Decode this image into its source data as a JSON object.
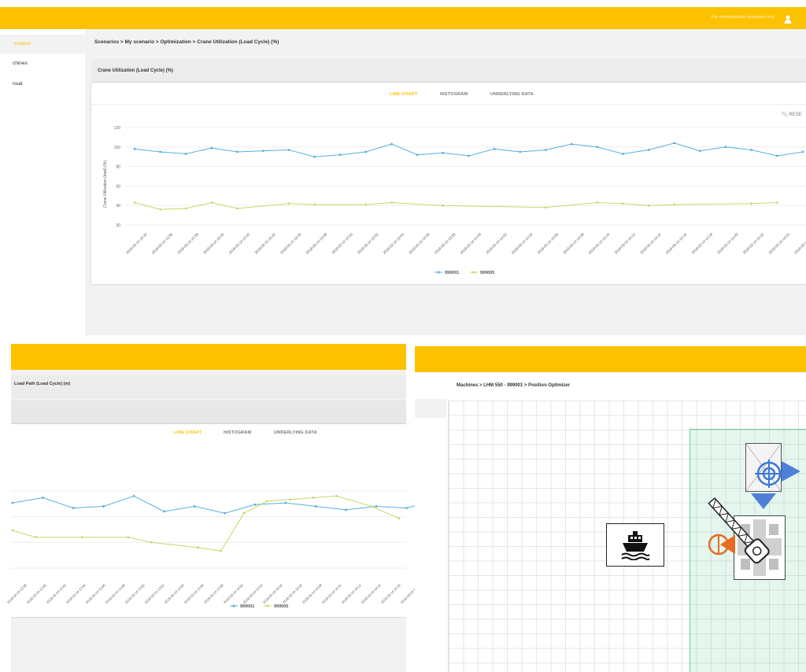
{
  "top": {
    "header_notice": "For demonstration purposes only",
    "sidebar": {
      "items": [
        {
          "label": "enarios",
          "active": true
        },
        {
          "label": "chines"
        },
        {
          "label": "nual"
        }
      ]
    },
    "breadcrumb": [
      "Scenarios",
      "My scenario",
      "Optimization",
      "Crane Utilization (Load Cycle) (%)"
    ],
    "card_title": "Crane Utilization (Load Cycle) (%)",
    "tabs": [
      "LINE CHART",
      "HISTOGRAM",
      "UNDERLYING DATA"
    ],
    "reset_label": "RESE"
  },
  "bottom_left": {
    "card_title": "Load Path (Load Cycle) (m)",
    "tabs": [
      "LINE CHART",
      "HISTOGRAM",
      "UNDERLYING DATA"
    ]
  },
  "bottom_right": {
    "breadcrumb": [
      "Machines",
      "LHM 550 - 999001",
      "Position Optimizer"
    ]
  },
  "colors": {
    "accent": "#fcc200",
    "series1": "#5aaee0",
    "series2": "#c6d86a",
    "zone": "#2eb873"
  },
  "chart_data": [
    {
      "type": "line",
      "ylabel": "Crane Utilization (load) (%)",
      "yticks": [
        20,
        40,
        60,
        80,
        100,
        120
      ],
      "ylim": [
        20,
        120
      ],
      "grid": true,
      "legend_position": "bottom",
      "x": [
        "2018-03-14 13:34",
        "2018-03-14 13:36",
        "2018-03-14 13:38",
        "2018-03-14 13:40",
        "2018-03-14 13:42",
        "2018-03-14 13:44",
        "2018-03-14 13:46",
        "2018-03-14 13:48",
        "2018-03-14 13:50",
        "2018-03-14 13:52",
        "2018-03-14 13:54",
        "2018-03-14 13:56",
        "2018-03-14 13:58",
        "2018-03-14 14:00",
        "2018-03-14 14:02",
        "2018-03-14 14:04",
        "2018-03-14 14:06",
        "2018-03-14 14:08",
        "2018-03-14 14:10",
        "2018-03-14 14:12",
        "2018-03-14 14:14",
        "2018-03-14 14:16",
        "2018-03-14 14:18",
        "2018-03-14 14:20",
        "2018-03-14 14:22",
        "2018-03-14 14:24",
        "2018-03-14 14:26"
      ],
      "series": [
        {
          "name": "999001",
          "values": [
            98,
            95,
            93,
            99,
            95,
            96,
            97,
            90,
            92,
            95,
            103,
            92,
            94,
            91,
            98,
            95,
            97,
            103,
            100,
            93,
            97,
            104,
            96,
            100,
            97,
            91,
            95
          ]
        },
        {
          "name": "999005",
          "values": [
            43,
            36,
            37,
            43,
            37,
            null,
            42,
            41,
            null,
            41,
            43,
            null,
            40,
            null,
            null,
            null,
            38,
            null,
            43,
            42,
            40,
            41,
            null,
            null,
            42,
            43,
            null
          ]
        }
      ]
    },
    {
      "type": "line",
      "legend_position": "bottom",
      "x": [
        "2018-03-14 13:38",
        "2018-03-14 13:40",
        "2018-03-14 13:42",
        "2018-03-14 13:44",
        "2018-03-14 13:46",
        "2018-03-14 13:48",
        "2018-03-14 13:50",
        "2018-03-14 13:52",
        "2018-03-14 13:54",
        "2018-03-14 13:56",
        "2018-03-14 13:58",
        "2018-03-14 14:00",
        "2018-03-14 14:02",
        "2018-03-14 14:04",
        "2018-03-14 14:06",
        "2018-03-14 14:08",
        "2018-03-14 14:10",
        "2018-03-14 14:12",
        "2018-03-14 14:14",
        "2018-03-14 14:16",
        "2018-03-14 14:18"
      ],
      "series": [
        {
          "name": "999001",
          "values": [
            68,
            71,
            65,
            66,
            72,
            63,
            66,
            62,
            67,
            68,
            66,
            64,
            66,
            65,
            70,
            66
          ]
        },
        {
          "name": "999005",
          "values": [
            52,
            48,
            48,
            48,
            45,
            42,
            40,
            62,
            69,
            70,
            71,
            72,
            66,
            59
          ]
        }
      ]
    }
  ]
}
